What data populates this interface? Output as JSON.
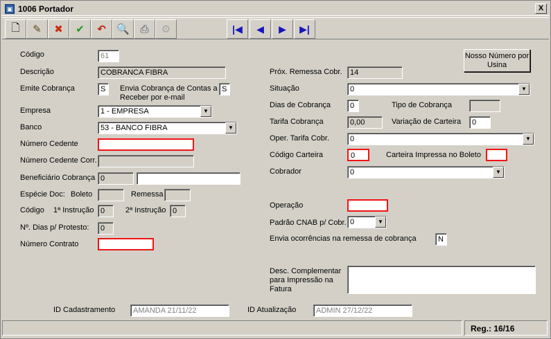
{
  "window": {
    "title": "1006 Portador",
    "close_label": "X"
  },
  "toolbar": {
    "buttons": [
      {
        "name": "new-doc",
        "glyph": "🗋"
      },
      {
        "name": "edit",
        "glyph": "✎"
      },
      {
        "name": "delete",
        "glyph": "✖"
      },
      {
        "name": "confirm",
        "glyph": "✔"
      },
      {
        "name": "undo",
        "glyph": "↶"
      },
      {
        "name": "search",
        "glyph": "🔍"
      },
      {
        "name": "print",
        "glyph": "⎙"
      },
      {
        "name": "disabled-tool",
        "glyph": "⚙"
      }
    ],
    "nav": {
      "first": "|◀",
      "prev": "◀",
      "next": "▶",
      "last": "▶|"
    }
  },
  "left": {
    "codigo_label": "Código",
    "codigo_value": "61",
    "descricao_label": "Descrição",
    "descricao_value": "COBRANCA FIBRA",
    "emite_label": "Emite Cobrança",
    "emite_value": "S",
    "envia_email_label": "Envia Cobrança de Contas a Receber por e-mail",
    "envia_email_value": "S",
    "empresa_label": "Empresa",
    "empresa_value": "1 - EMPRESA",
    "banco_label": "Banco",
    "banco_value": "53 - BANCO FIBRA",
    "numero_cedente_label": "Número Cedente",
    "numero_cedente_value": "",
    "numero_cedente_corr_label": "Número Cedente Corr.",
    "numero_cedente_corr_value": "",
    "beneficiario_label": "Beneficiário Cobrança",
    "beneficiario_code": "0",
    "beneficiario_name": "",
    "especie_label": "Espécie Doc:",
    "boleto_label": "Boleto",
    "boleto_value": "",
    "remessa_label": "Remessa",
    "remessa_value": "",
    "codigo2_label": "Código",
    "instrucao1_label": "1ª Instrução",
    "instrucao1_value": "0",
    "instrucao2_label": "2ª Instrução",
    "instrucao2_value": "0",
    "dias_protesto_label": "Nº. Dias p/ Protesto:",
    "dias_protesto_value": "0",
    "numero_contrato_label": "Número Contrato",
    "numero_contrato_value": ""
  },
  "right": {
    "nosso_numero_button": "Nosso Número por Usina",
    "prox_remessa_label": "Próx. Remessa Cobr.",
    "prox_remessa_value": "14",
    "situacao_label": "Situação",
    "situacao_value": "0",
    "dias_cobranca_label": "Dias de Cobrança",
    "dias_cobranca_value": "0",
    "tipo_cobranca_label": "Tipo de Cobrança",
    "tipo_cobranca_value": "",
    "tarifa_label": "Tarifa Cobrança",
    "tarifa_value": "0,00",
    "variacao_label": "Variação de Carteira",
    "variacao_value": "0",
    "oper_tarifa_label": "Oper. Tarifa Cobr.",
    "oper_tarifa_value": "0",
    "codigo_carteira_label": "Código Carteira",
    "codigo_carteira_value": "0",
    "carteira_impressa_label": "Carteira Impressa no Boleto",
    "carteira_impressa_value": "",
    "cobrador_label": "Cobrador",
    "cobrador_value": "0",
    "operacao_label": "Operação",
    "operacao_value": "",
    "padrao_cnab_label": "Padrão CNAB p/ Cobr.",
    "padrao_cnab_value": "0",
    "envia_ocorrencias_label": "Envia ocorrências na remessa de cobrança",
    "envia_ocorrencias_value": "N",
    "desc_complementar_label": "Desc. Complementar para Impressão na Fatura",
    "desc_complementar_value": ""
  },
  "footer": {
    "id_cadastramento_label": "ID Cadastramento",
    "id_cadastramento_value": "AMANDA 21/11/22",
    "id_atualizacao_label": "ID Atualização",
    "id_atualizacao_value": "ADMIN 27/12/22"
  },
  "status": {
    "record": "Reg.: 16/16"
  },
  "colors": {
    "required_border": "#f01414",
    "nav_arrow": "#1616b8",
    "window_bg": "#d4d0c8"
  }
}
